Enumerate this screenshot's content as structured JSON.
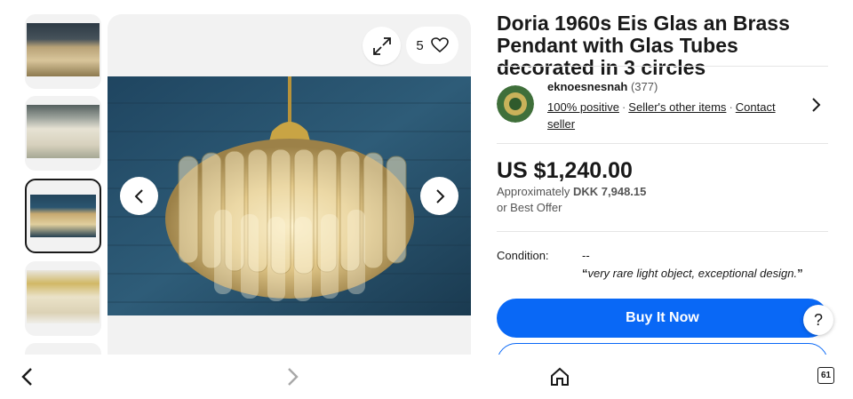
{
  "gallery": {
    "image_count": "5",
    "thumbnails": [
      "chandelier-thumb-1",
      "chandelier-thumb-2",
      "chandelier-thumb-3",
      "chandelier-thumb-4",
      "chandelier-thumb-5"
    ],
    "selected_index": 2
  },
  "listing": {
    "title": "Doria 1960s Eis Glas an Brass Pendant with Glas Tubes decorated in 3 circles"
  },
  "seller": {
    "name": "eknoesnesnah",
    "feedback_count": "(377)",
    "positive": "100% positive",
    "other_items": "Seller's other items",
    "contact": "Contact seller"
  },
  "price": {
    "main": "US $1,240.00",
    "approx_prefix": "Approximately",
    "approx_value": "DKK 7,948.15",
    "best_offer": "or Best Offer"
  },
  "condition": {
    "label": "Condition:",
    "value": "--",
    "quote_open": "“",
    "description": "very rare light object, exceptional design.",
    "quote_close": "”"
  },
  "actions": {
    "buy_now": "Buy It Now",
    "help": "?"
  },
  "bottom_nav": {
    "tab_count": "61"
  },
  "colors": {
    "accent": "#0968f6",
    "text": "#191919",
    "muted": "#555555"
  }
}
